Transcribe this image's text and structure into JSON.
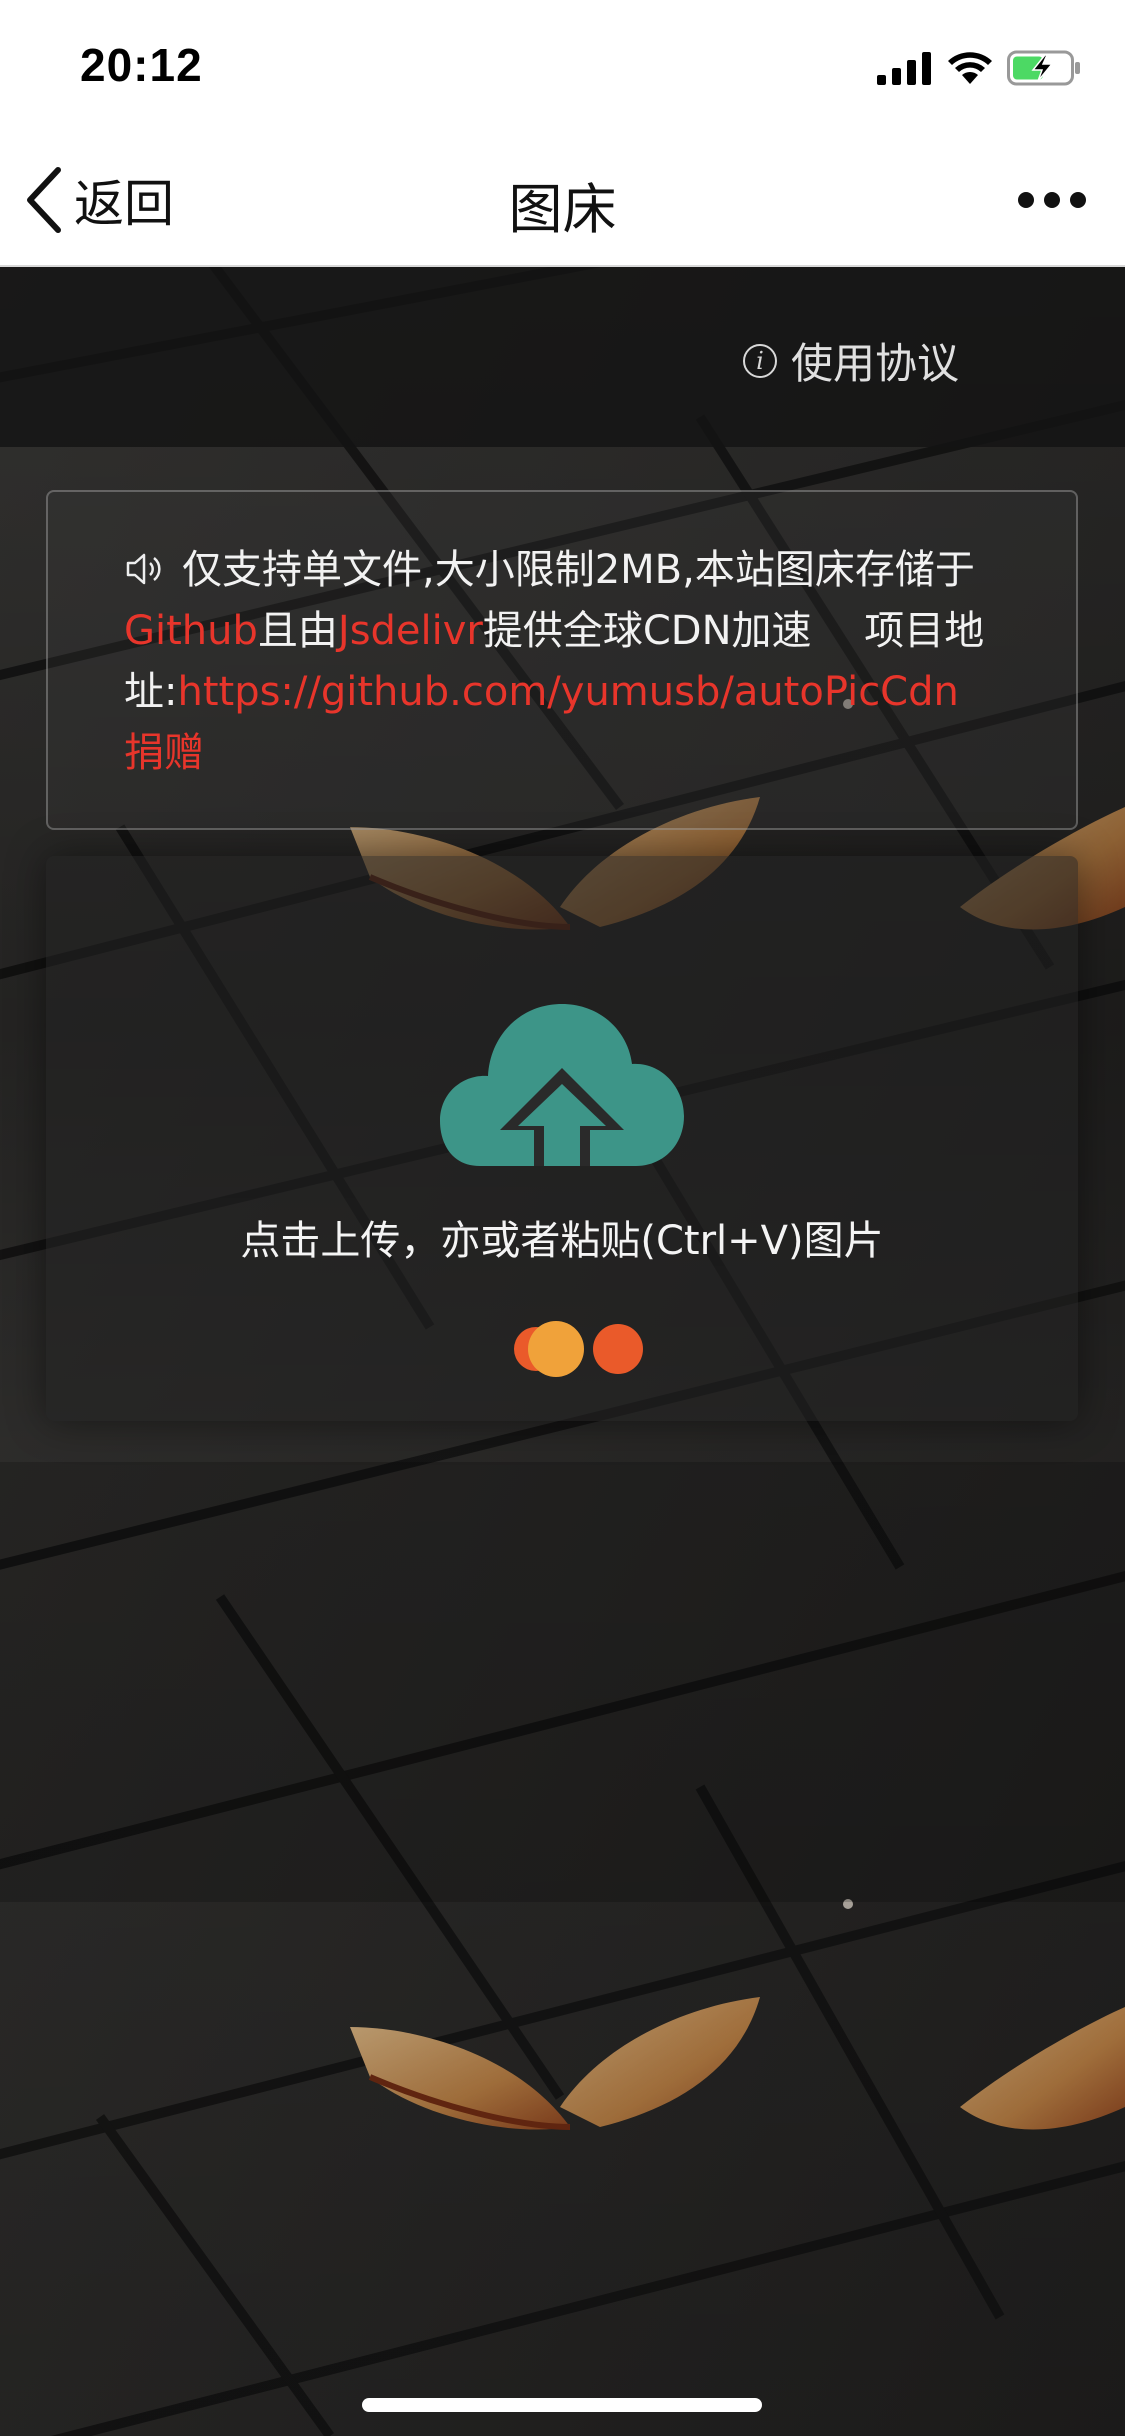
{
  "status_bar": {
    "time": "20:12",
    "icons": [
      "signal-icon",
      "wifi-icon",
      "battery-charging-icon"
    ]
  },
  "nav": {
    "back_label": "返回",
    "title": "图床",
    "more_icon": "more-dots-icon"
  },
  "toolbar": {
    "agreement_label": "使用协议",
    "agreement_icon": "info-icon"
  },
  "notice": {
    "icon": "speaker-icon",
    "text_1": "仅支持单文件,大小限制2MB,本站图床存储于",
    "link_github": "Github",
    "text_2": "且由",
    "link_jsdelivr": "Jsdelivr",
    "text_3": "提供全球CDN加速　 项目地址:",
    "link_repo": "https://github.com/yumusb/autoPicCdn",
    "link_donate": "捐赠"
  },
  "upload": {
    "icon": "cloud-upload-icon",
    "hint": "点击上传，亦或者粘贴(Ctrl+V)图片",
    "loader_icon": "loading-dots-icon"
  },
  "colors": {
    "accent": "#3d9588",
    "link": "#e8352b",
    "loader_a": "#f0a23a",
    "loader_b": "#ea5a2a"
  }
}
